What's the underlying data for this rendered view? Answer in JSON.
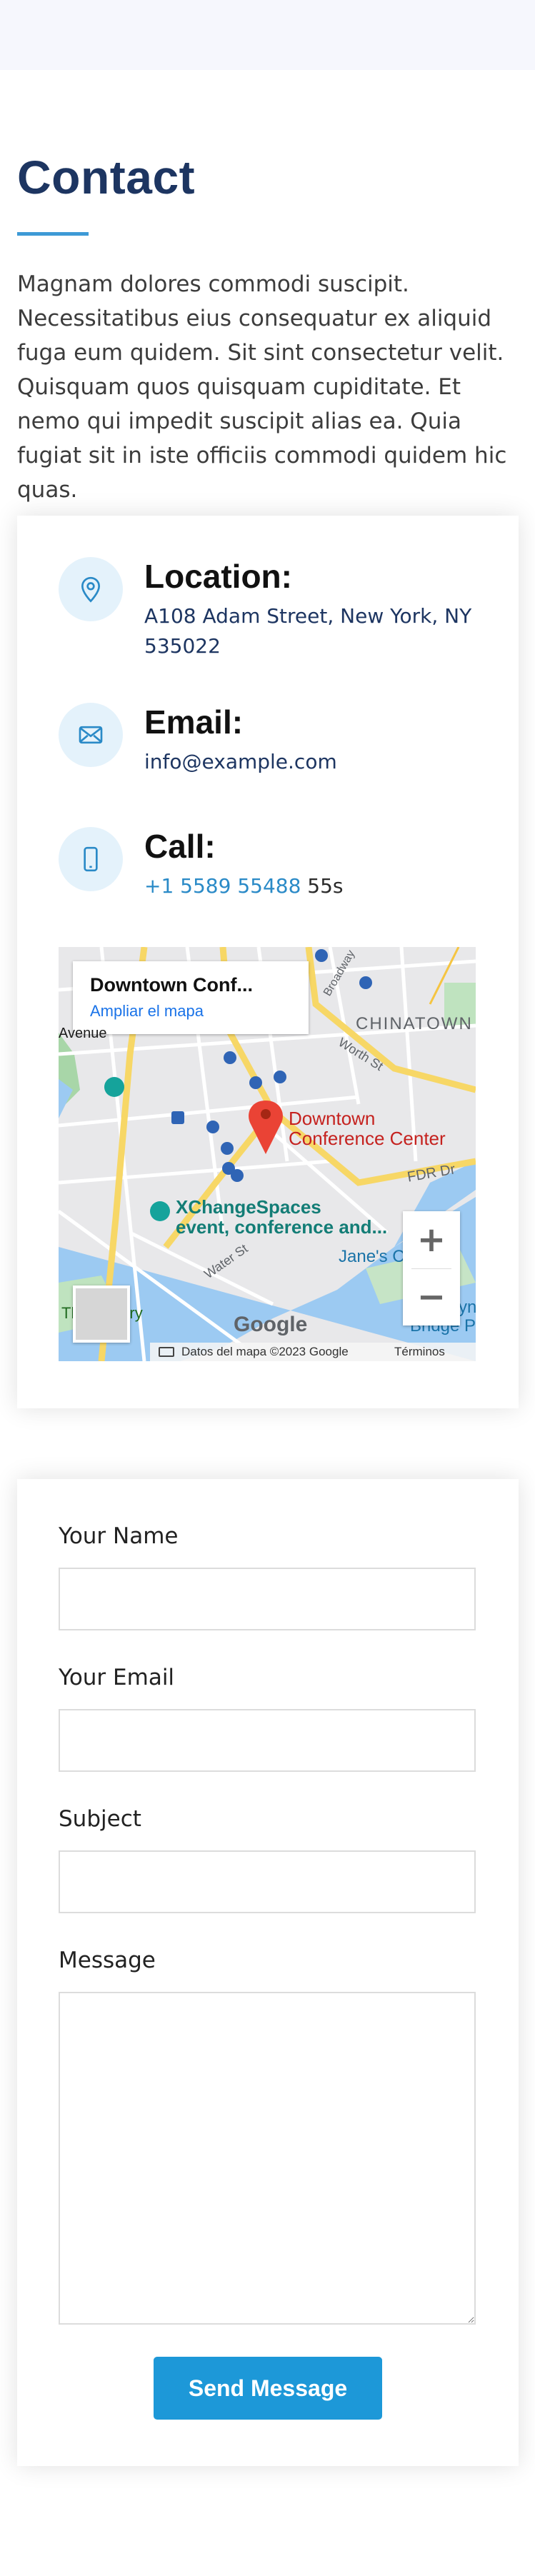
{
  "colors": {
    "heading": "#1d3561",
    "accent": "#3d9ad6",
    "icon_bg": "#e4f2fb",
    "button": "#1d98d8",
    "link": "#2a8ac7"
  },
  "section": {
    "title": "Contact",
    "intro": "Magnam dolores commodi suscipit. Necessitatibus eius consequatur ex aliquid fuga eum quidem. Sit sint consectetur velit. Quisquam quos quisquam cupiditate. Et nemo qui impedit suscipit alias ea. Quia fugiat sit in iste officiis commodi quidem hic quas."
  },
  "info": {
    "location": {
      "icon": "map-pin-icon",
      "heading": "Location:",
      "text": "A108 Adam Street, New York, NY 535022"
    },
    "email": {
      "icon": "envelope-icon",
      "heading": "Email:",
      "text": "info@example.com"
    },
    "call": {
      "icon": "phone-icon",
      "heading": "Call:",
      "text_link": "+1 5589 55488",
      "text_rest": " 55s"
    }
  },
  "map": {
    "popup_title": "Downtown Conf...",
    "popup_link": "Ampliar el mapa",
    "pin_label_line1": "Downtown",
    "pin_label_line2": "Conference Center",
    "place_label_line1": "XChangeSpaces",
    "place_label_line2": "event, conference and...",
    "district_label": "CHINATOWN",
    "street_worth": "Worth St",
    "street_water": "Water St",
    "street_fdr": "FDR Dr",
    "street_broadway": "Broadway",
    "park_label": "Jane's Carousel",
    "bridge_label_line1": "Brooklyn",
    "bridge_label_line2": "Bridge Park",
    "battery_label": "The Battery",
    "nevins_label": "Avenue",
    "zoom_in": "+",
    "zoom_out": "−",
    "google": "Google",
    "attribution": "Datos del mapa ©2023 Google",
    "terms": "Términos"
  },
  "form": {
    "name_label": "Your Name",
    "email_label": "Your Email",
    "subject_label": "Subject",
    "message_label": "Message",
    "name_value": "",
    "email_value": "",
    "subject_value": "",
    "message_value": "",
    "submit_label": "Send Message"
  }
}
